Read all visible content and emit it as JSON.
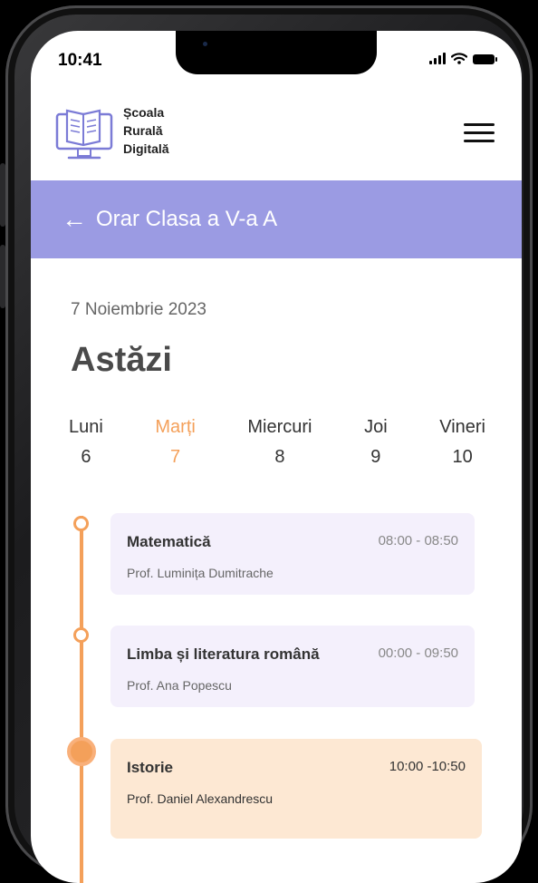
{
  "status": {
    "time": "10:41"
  },
  "brand": {
    "line1": "Școala",
    "line2": "Rurală",
    "line3": "Digitală"
  },
  "title_bar": {
    "back_icon": "←",
    "title": "Orar Clasa a V-a A"
  },
  "date": "7 Noiembrie 2023",
  "today": "Astăzi",
  "days": [
    {
      "name": "Luni",
      "num": "6"
    },
    {
      "name": "Marți",
      "num": "7"
    },
    {
      "name": "Miercuri",
      "num": "8"
    },
    {
      "name": "Joi",
      "num": "9"
    },
    {
      "name": "Vineri",
      "num": "10"
    }
  ],
  "classes": [
    {
      "subject": "Matematică",
      "time": "08:00 - 08:50",
      "teacher": "Prof. Luminița Dumitrache"
    },
    {
      "subject": "Limba și literatura română",
      "time": "00:00 - 09:50",
      "teacher": "Prof. Ana Popescu"
    },
    {
      "subject": "Istorie",
      "time": "10:00 -10:50",
      "teacher": "Prof. Daniel Alexandrescu"
    }
  ],
  "colors": {
    "accent": "#f4a05a",
    "header": "#9b9be3",
    "card": "#f4f0fc",
    "card_active": "#fde8d3"
  }
}
